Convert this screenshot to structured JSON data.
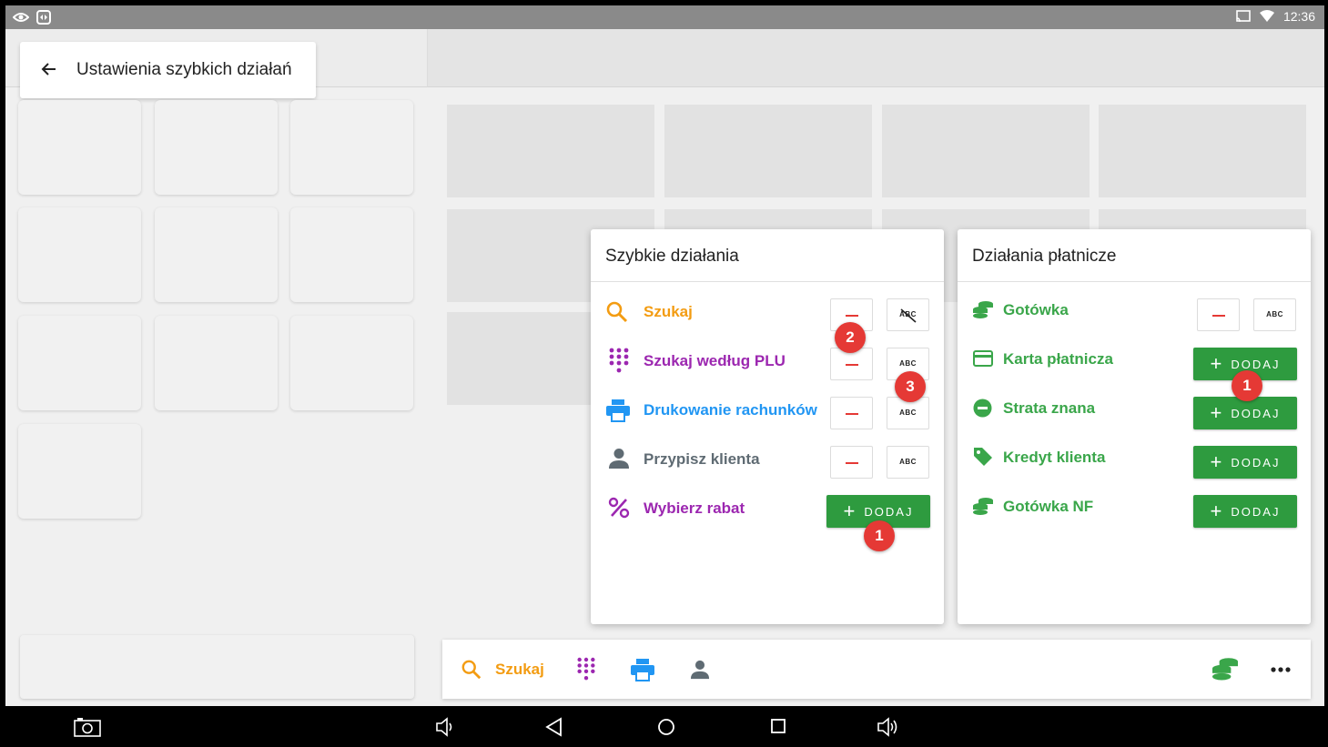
{
  "status_bar": {
    "time": "12:36"
  },
  "header": {
    "title": "Ustawienia szybkich działań"
  },
  "quick_actions": {
    "title": "Szybkie działania",
    "items": [
      {
        "label": "Szukaj",
        "color": "#f39c12"
      },
      {
        "label": "Szukaj według PLU",
        "color": "#9c27b0"
      },
      {
        "label": "Drukowanie rachunków",
        "color": "#2196f3"
      },
      {
        "label": "Przypisz klienta",
        "color": "#5f6b73"
      },
      {
        "label": "Wybierz rabat",
        "color": "#9c27b0"
      }
    ],
    "abc_label": "ABC",
    "add_label": "DODAJ"
  },
  "payment_actions": {
    "title": "Działania płatnicze",
    "items": [
      {
        "label": "Gotówka",
        "color": "#3aa64a"
      },
      {
        "label": "Karta płatnicza",
        "color": "#3aa64a"
      },
      {
        "label": "Strata znana",
        "color": "#3aa64a"
      },
      {
        "label": "Kredyt klienta",
        "color": "#3aa64a"
      },
      {
        "label": "Gotówka NF",
        "color": "#3aa64a"
      }
    ],
    "abc_label": "ABC",
    "add_label": "DODAJ"
  },
  "badges": [
    "2",
    "3",
    "1",
    "1"
  ],
  "toolbar": {
    "search_label": "Szukaj"
  }
}
